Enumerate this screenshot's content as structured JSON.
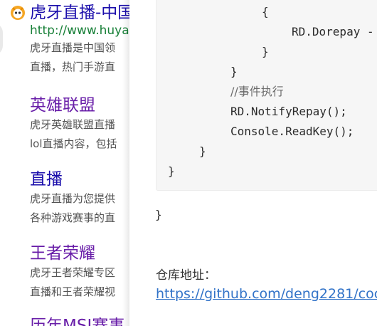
{
  "search_results": [
    {
      "title": "虎牙直播-中国",
      "url": "http://www.huya",
      "snippet": [
        "虎牙直播是中国领",
        "直播，热门手游直"
      ]
    },
    {
      "title": "英雄联盟",
      "snippet": [
        "虎牙英雄联盟直播",
        "lol直播内容，包括"
      ]
    },
    {
      "title": "直播",
      "snippet": [
        "虎牙直播为您提供",
        "各种游戏赛事的直"
      ]
    },
    {
      "title": "王者荣耀",
      "snippet": [
        "虎牙王者荣耀专区",
        "直播和王者荣耀视"
      ]
    },
    {
      "title": "历年MSI赛事"
    }
  ],
  "article": {
    "code_lines": [
      "{",
      "RD.Dorepay -",
      "}",
      "}",
      "//事件执行",
      "RD.NotifyRepay();",
      "Console.ReadKey();",
      "}",
      "}"
    ],
    "outer_brace": "}",
    "repo_label": "仓库地址：",
    "repo_link": "https://github.com/deng2281/coc"
  },
  "colors": {
    "link_blue": "#1a0dab",
    "link_visited": "#681da8",
    "url_green": "#188038",
    "article_link": "#3273c8",
    "code_bg": "#f6f6f6"
  },
  "icons": {
    "favicon": "huya-tiger-icon"
  }
}
